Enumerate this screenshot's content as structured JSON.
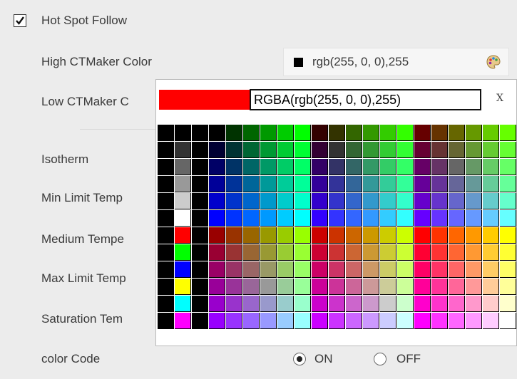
{
  "hot_spot": {
    "label": "Hot Spot Follow",
    "checked": true
  },
  "high_color": {
    "label": "High CTMaker Color",
    "value": "rgb(255, 0, 0),255"
  },
  "low_color": {
    "label": "Low CTMaker C"
  },
  "isotherm": {
    "label": "Isotherm"
  },
  "min_limit": {
    "label": "Min Limit Temp"
  },
  "medium": {
    "label": "Medium Tempe"
  },
  "max_limit": {
    "label": "Max Limit Temp"
  },
  "saturation": {
    "label": "Saturation Tem"
  },
  "color_code": {
    "label": "color Code",
    "on_label": "ON",
    "off_label": "OFF",
    "selected": "ON"
  },
  "picker": {
    "preview_color": "#ff0000",
    "value": "RGBA(rgb(255, 0, 0),255)",
    "close_label": "X"
  }
}
